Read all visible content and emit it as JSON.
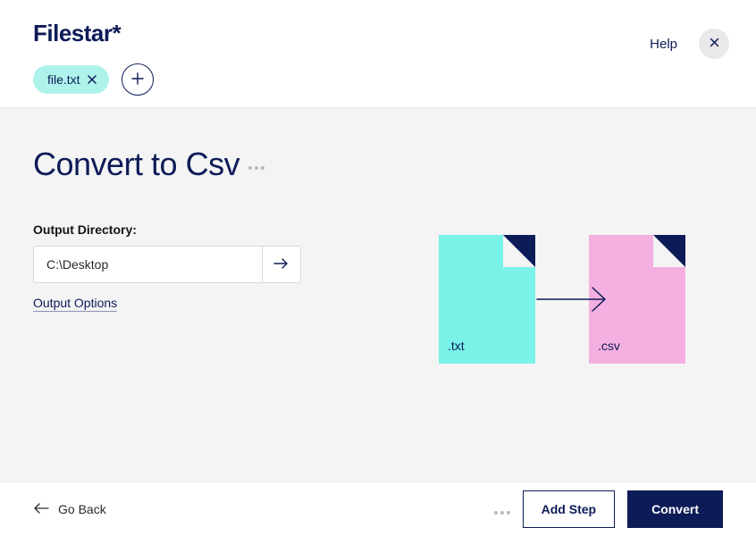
{
  "header": {
    "logo": "Filestar*",
    "file_chip": {
      "label": "file.txt"
    },
    "help_label": "Help"
  },
  "main": {
    "title": "Convert to Csv",
    "output_dir_label": "Output Directory:",
    "output_dir_value": "C:\\Desktop",
    "output_options_label": "Output Options",
    "diagram": {
      "source_ext": ".txt",
      "target_ext": ".csv"
    }
  },
  "footer": {
    "go_back_label": "Go Back",
    "add_step_label": "Add Step",
    "convert_label": "Convert"
  }
}
